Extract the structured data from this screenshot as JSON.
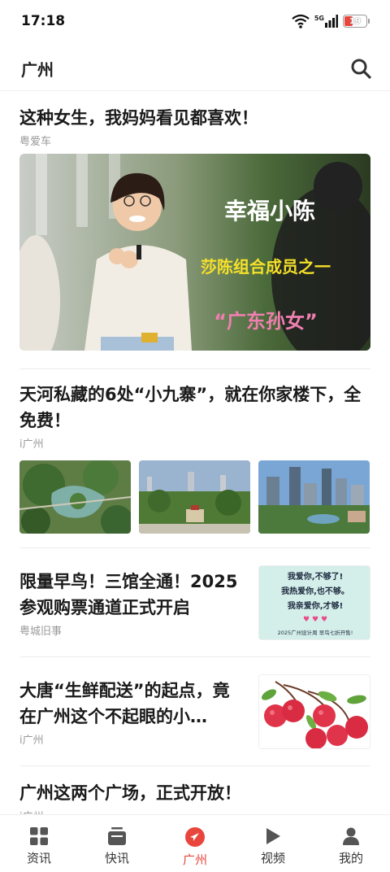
{
  "status": {
    "time": "17:18",
    "battery": "19",
    "network": "5G"
  },
  "header": {
    "title": "广州"
  },
  "articles": [
    {
      "title": "这种女生，我妈妈看见都喜欢！",
      "source": "粤爱车",
      "image_text": {
        "line1": "幸福小陈",
        "line2": "莎陈组合成员之一",
        "line3": "“广东孙女”"
      }
    },
    {
      "title": "天河私藏的6处“小九寨”，就在你家楼下，全免费！",
      "source": "i广州"
    },
    {
      "title": "限量早鸟！三馆全通！2025参观购票通道正式开启",
      "source": "粤城旧事",
      "image_text": {
        "line1": "我爱你,不够了!",
        "line2": "我热爱你,也不够。",
        "line3": "我亲爱你,才够!",
        "line4": "2025广州设计周 早鸟七折开售!"
      }
    },
    {
      "title": "大唐“生鲜配送”的起点，竟在广州这个不起眼的小…",
      "source": "i广州"
    },
    {
      "title": "广州这两个广场，正式开放！",
      "source": "i广州"
    }
  ],
  "nav": [
    {
      "label": "资讯",
      "icon": "grid-icon"
    },
    {
      "label": "快讯",
      "icon": "tv-icon"
    },
    {
      "label": "广州",
      "icon": "location-arrow-icon",
      "active": true
    },
    {
      "label": "视频",
      "icon": "play-icon"
    },
    {
      "label": "我的",
      "icon": "user-icon"
    }
  ],
  "colors": {
    "accent": "#e8453c"
  }
}
